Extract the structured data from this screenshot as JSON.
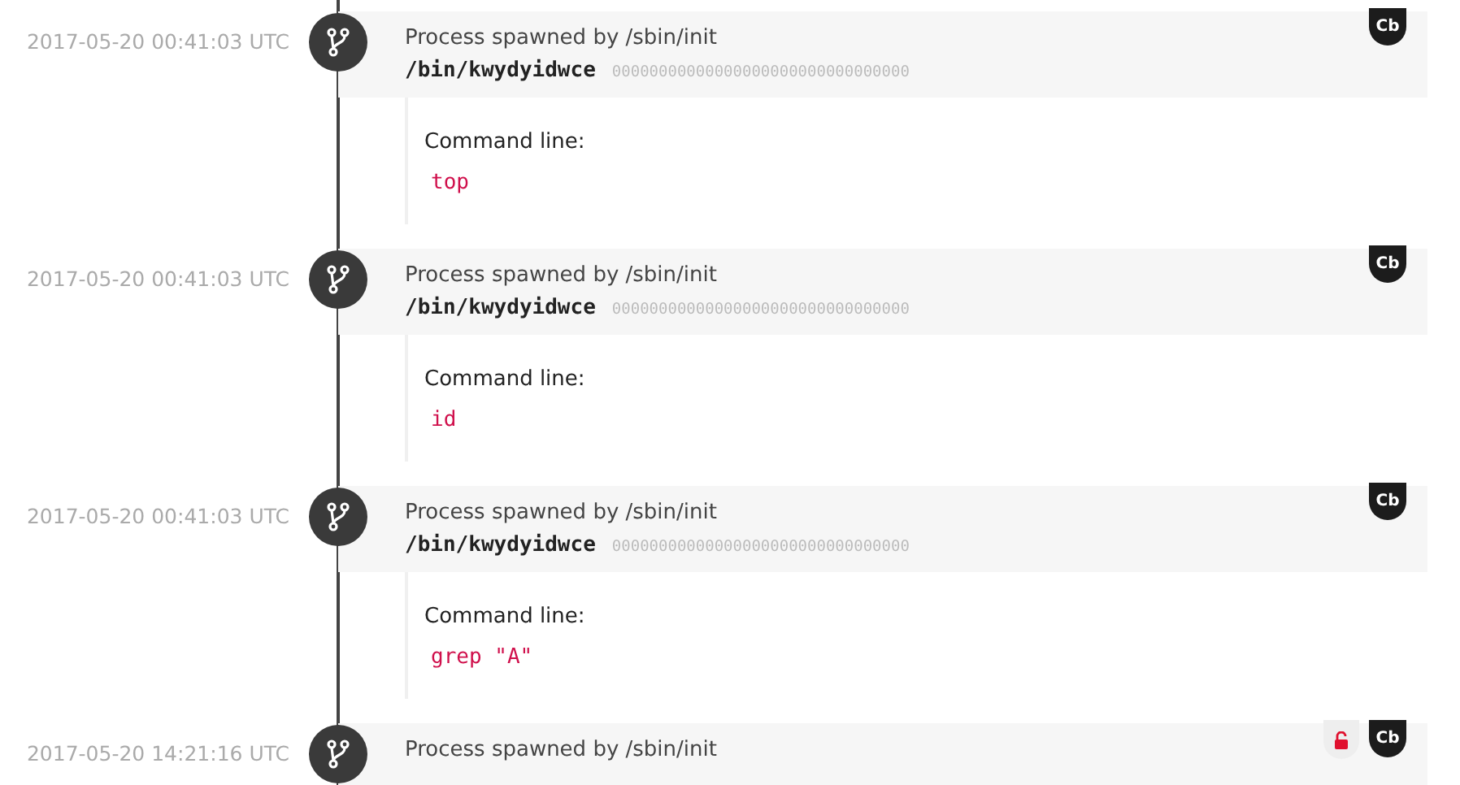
{
  "events": [
    {
      "timestamp": "2017-05-20 00:41:03 UTC",
      "title": "Process spawned by /sbin/init",
      "path": "/bin/kwydyidwce",
      "hash": "00000000000000000000000000000000",
      "command_label": "Command line:",
      "command": "top",
      "badges": [
        {
          "kind": "tag",
          "text": "Cb"
        }
      ]
    },
    {
      "timestamp": "2017-05-20 00:41:03 UTC",
      "title": "Process spawned by /sbin/init",
      "path": "/bin/kwydyidwce",
      "hash": "00000000000000000000000000000000",
      "command_label": "Command line:",
      "command": "id",
      "badges": [
        {
          "kind": "tag",
          "text": "Cb"
        }
      ]
    },
    {
      "timestamp": "2017-05-20 00:41:03 UTC",
      "title": "Process spawned by /sbin/init",
      "path": "/bin/kwydyidwce",
      "hash": "00000000000000000000000000000000",
      "command_label": "Command line:",
      "command": "grep \"A\"",
      "badges": [
        {
          "kind": "tag",
          "text": "Cb"
        }
      ]
    },
    {
      "timestamp": "2017-05-20 14:21:16 UTC",
      "title": "Process spawned by /sbin/init",
      "badges": [
        {
          "kind": "lock"
        },
        {
          "kind": "tag",
          "text": "Cb"
        }
      ]
    }
  ]
}
